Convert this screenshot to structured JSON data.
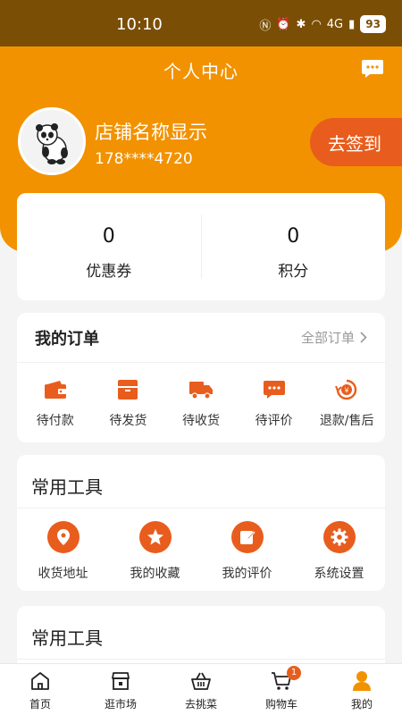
{
  "status_bar": {
    "time": "10:10",
    "network": "4G",
    "battery": "93"
  },
  "header": {
    "title": "个人中心",
    "message_icon": "chat-bubble-icon",
    "shop_name": "店铺名称显示",
    "phone": "178****4720",
    "signin_label": "去签到"
  },
  "stats": [
    {
      "value": "0",
      "label": "优惠券"
    },
    {
      "value": "0",
      "label": "积分"
    }
  ],
  "orders": {
    "title": "我的订单",
    "all_link": "全部订单",
    "items": [
      {
        "label": "待付款",
        "icon": "wallet-icon"
      },
      {
        "label": "待发货",
        "icon": "box-icon"
      },
      {
        "label": "待收货",
        "icon": "truck-icon"
      },
      {
        "label": "待评价",
        "icon": "comment-icon"
      },
      {
        "label": "退款/售后",
        "icon": "refund-icon"
      }
    ]
  },
  "tools": {
    "title": "常用工具",
    "items": [
      {
        "label": "收货地址",
        "icon": "location-icon"
      },
      {
        "label": "我的收藏",
        "icon": "star-icon"
      },
      {
        "label": "我的评价",
        "icon": "edit-icon"
      },
      {
        "label": "系统设置",
        "icon": "gear-icon"
      }
    ]
  },
  "tools2": {
    "title": "常用工具"
  },
  "bottom_nav": [
    {
      "label": "首页",
      "icon": "home-icon"
    },
    {
      "label": "逛市场",
      "icon": "store-icon"
    },
    {
      "label": "去挑菜",
      "icon": "basket-icon"
    },
    {
      "label": "购物车",
      "icon": "cart-icon",
      "badge": "1"
    },
    {
      "label": "我的",
      "icon": "user-icon",
      "active": true
    }
  ],
  "colors": {
    "brand_orange": "#f29200",
    "accent_red_orange": "#e85d1d",
    "status_bar": "#7a4e05"
  }
}
